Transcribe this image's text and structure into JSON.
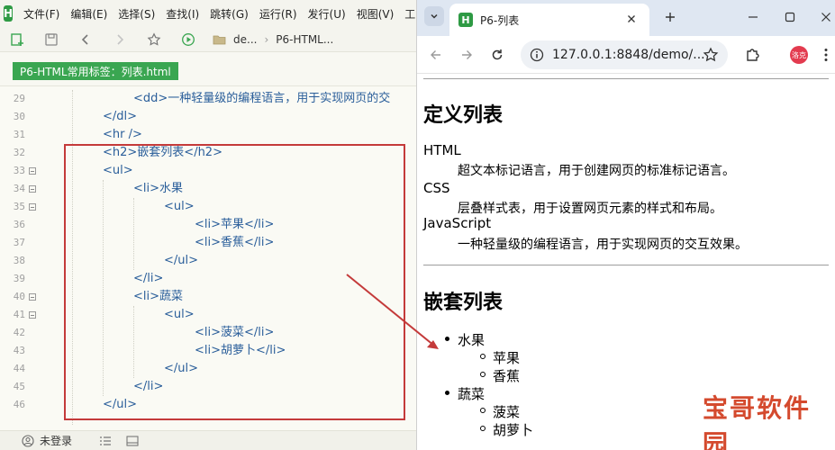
{
  "ide": {
    "menu": [
      "文件(F)",
      "编辑(E)",
      "选择(S)",
      "查找(I)",
      "跳转(G)",
      "运行(R)",
      "发行(U)",
      "视图(V)",
      "工"
    ],
    "breadcrumbs": [
      "de...",
      "P6-HTML..."
    ],
    "file_tab": "P6-HTML常用标签：列表.html",
    "code_lines": [
      {
        "n": "29",
        "text": "<dd>一种轻量级的编程语言，用于实现网页的交",
        "fold": false
      },
      {
        "n": "30",
        "text": "</dl>",
        "fold": false
      },
      {
        "n": "31",
        "text": "<hr />",
        "fold": false
      },
      {
        "n": "32",
        "text": "<h2>嵌套列表</h2>",
        "fold": false
      },
      {
        "n": "33",
        "text": "<ul>",
        "fold": true
      },
      {
        "n": "34",
        "text": "<li>水果",
        "fold": true
      },
      {
        "n": "35",
        "text": "<ul>",
        "fold": true
      },
      {
        "n": "36",
        "text": "<li>苹果</li>",
        "fold": false
      },
      {
        "n": "37",
        "text": "<li>香蕉</li>",
        "fold": false
      },
      {
        "n": "38",
        "text": "</ul>",
        "fold": false
      },
      {
        "n": "39",
        "text": "</li>",
        "fold": false
      },
      {
        "n": "40",
        "text": "<li>蔬菜",
        "fold": true
      },
      {
        "n": "41",
        "text": "<ul>",
        "fold": true
      },
      {
        "n": "42",
        "text": "<li>菠菜</li>",
        "fold": false
      },
      {
        "n": "43",
        "text": "<li>胡萝卜</li>",
        "fold": false
      },
      {
        "n": "44",
        "text": "</ul>",
        "fold": false
      },
      {
        "n": "45",
        "text": "</li>",
        "fold": false
      },
      {
        "n": "46",
        "text": "</ul>",
        "fold": false
      }
    ],
    "status_login": "未登录",
    "accent_color": "#3aa651"
  },
  "browser": {
    "tab_title": "P6-列表",
    "url": "127.0.0.1:8848/demo/...",
    "profile_label": "洛克"
  },
  "page": {
    "h2_def": "定义列表",
    "terms": [
      {
        "dt": "HTML",
        "dd": "超文本标记语言，用于创建网页的标准标记语言。"
      },
      {
        "dt": "CSS",
        "dd": "层叠样式表，用于设置网页元素的样式和布局。"
      },
      {
        "dt": "JavaScript",
        "dd": "一种轻量级的编程语言，用于实现网页的交互效果。"
      }
    ],
    "h2_nested": "嵌套列表",
    "fruit": "水果",
    "fruit_items": [
      "苹果",
      "香蕉"
    ],
    "veg": "蔬菜",
    "veg_items": [
      "菠菜",
      "胡萝卜"
    ]
  },
  "watermark": "宝哥软件园"
}
